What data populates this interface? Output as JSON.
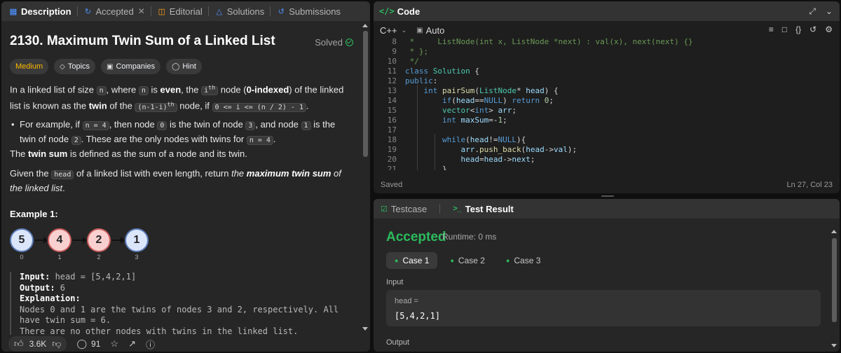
{
  "tabs": {
    "description": "Description",
    "accepted": "Accepted",
    "editorial": "Editorial",
    "solutions": "Solutions",
    "submissions": "Submissions"
  },
  "problem": {
    "title": "2130. Maximum Twin Sum of a Linked List",
    "status": "Solved",
    "difficulty": "Medium",
    "topics_label": "Topics",
    "companies_label": "Companies",
    "hint_label": "Hint"
  },
  "description": {
    "p1_a": "In a linked list of size ",
    "p1_n": "n",
    "p1_b": ", where ",
    "p1_n2": "n",
    "p1_c": " is ",
    "p1_even": "even",
    "p1_d": ", the ",
    "p1_ith": "i",
    "p1_ith_sup": "th",
    "p1_e": " node (",
    "p1_zero": "0-indexed",
    "p1_f": ") of the linked list is known as the ",
    "p1_twin": "twin",
    "p1_g": " of the ",
    "p1_expr": "(n-1-i)",
    "p1_expr_sup": "th",
    "p1_h": " node, if ",
    "p1_cond": "0 <= i <= (n / 2) - 1",
    "p1_i": ".",
    "bullet_a": "For example, if ",
    "bullet_n4": "n = 4",
    "bullet_b": ", then node ",
    "bullet_0": "0",
    "bullet_c": " is the twin of node ",
    "bullet_3": "3",
    "bullet_d": ", and node ",
    "bullet_1": "1",
    "bullet_e": " is the twin of node ",
    "bullet_2": "2",
    "bullet_f": ". These are the only nodes with twins for ",
    "bullet_n4b": "n = 4",
    "bullet_g": ".",
    "p2_a": "The ",
    "p2_b": "twin sum",
    "p2_c": " is defined as the sum of a node and its twin.",
    "p3_a": "Given the ",
    "p3_head": "head",
    "p3_b": " of a linked list with even length, return ",
    "p3_c": "the ",
    "p3_d": "maximum twin sum",
    "p3_e": " of the linked list",
    "p3_f": "."
  },
  "example": {
    "title": "Example 1:",
    "nodes": [
      {
        "value": "5",
        "index": "0",
        "color": "blue"
      },
      {
        "value": "4",
        "index": "1",
        "color": "red"
      },
      {
        "value": "2",
        "index": "2",
        "color": "red"
      },
      {
        "value": "1",
        "index": "3",
        "color": "blue"
      }
    ],
    "input_label": "Input:",
    "input_value": " head = [5,4,2,1]",
    "output_label": "Output:",
    "output_value": " 6",
    "explanation_label": "Explanation:",
    "explanation_text": "Nodes 0 and 1 are the twins of nodes 3 and 2, respectively. All have twin sum = 6.",
    "explanation_more": "There are no other nodes with twins in the linked list."
  },
  "footer": {
    "likes": "3.6K",
    "comments": "91"
  },
  "code_panel": {
    "title": "Code",
    "language": "C++",
    "mode": "Auto",
    "saved": "Saved",
    "cursor": "Ln 27, Col 23"
  },
  "code_lines": [
    {
      "n": "8",
      "text": " *     ListNode(int x, ListNode *next) : val(x), next(next) {}"
    },
    {
      "n": "9",
      "text": " * };"
    },
    {
      "n": "10",
      "text": " */"
    },
    {
      "n": "11",
      "text": "class Solution {"
    },
    {
      "n": "12",
      "text": "public:"
    },
    {
      "n": "13",
      "text": "    int pairSum(ListNode* head) {"
    },
    {
      "n": "14",
      "text": "        if(head==NULL) return 0;"
    },
    {
      "n": "15",
      "text": "        vector<int> arr;"
    },
    {
      "n": "16",
      "text": "        int maxSum=-1;"
    },
    {
      "n": "17",
      "text": ""
    },
    {
      "n": "18",
      "text": "        while(head!=NULL){"
    },
    {
      "n": "19",
      "text": "            arr.push_back(head->val);"
    },
    {
      "n": "20",
      "text": "            head=head->next;"
    },
    {
      "n": "21",
      "text": "        }"
    }
  ],
  "test_panel": {
    "testcase_tab": "Testcase",
    "result_tab": "Test Result",
    "verdict": "Accepted",
    "runtime": "Runtime: 0 ms",
    "cases": [
      "Case 1",
      "Case 2",
      "Case 3"
    ],
    "input_label": "Input",
    "var_name": "head =",
    "var_value": "[5,4,2,1]",
    "output_label": "Output"
  },
  "colors": {
    "accent_green": "#2cbb5d",
    "difficulty_medium": "#ffb800",
    "panel_bg": "#262626",
    "editor_bg": "#1e1e1e"
  }
}
